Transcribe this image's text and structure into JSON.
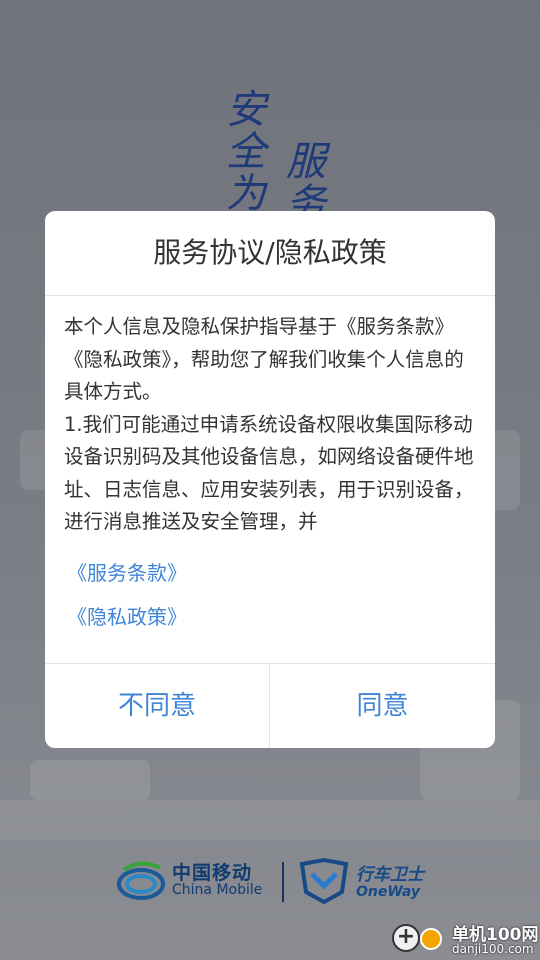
{
  "splash": {
    "slogan_left": "安全为",
    "slogan_right": "服务",
    "brand_left_cn": "中国移动",
    "brand_left_en": "China Mobile",
    "brand_right_cn": "行车卫士",
    "brand_right_en": "OneWay"
  },
  "dialog": {
    "title": "服务协议/隐私政策",
    "body": "本个人信息及隐私保护指导基于《服务条款》《隐私政策》，帮助您了解我们收集个人信息的具体方式。\n1.我们可能通过申请系统设备权限收集国际移动设备识别码及其他设备信息，如网络设备硬件地址、日志信息、应用安装列表，用于识别设备，进行消息推送及安全管理，并",
    "link_terms": "《服务条款》",
    "link_privacy": "《隐私政策》",
    "btn_disagree": "不同意",
    "btn_agree": "同意"
  },
  "watermark": {
    "name": "单机100网",
    "url": "danji100.com"
  },
  "colors": {
    "link": "#3f86d6",
    "title_text": "#333333",
    "brand_blue": "#0f3b6f"
  }
}
